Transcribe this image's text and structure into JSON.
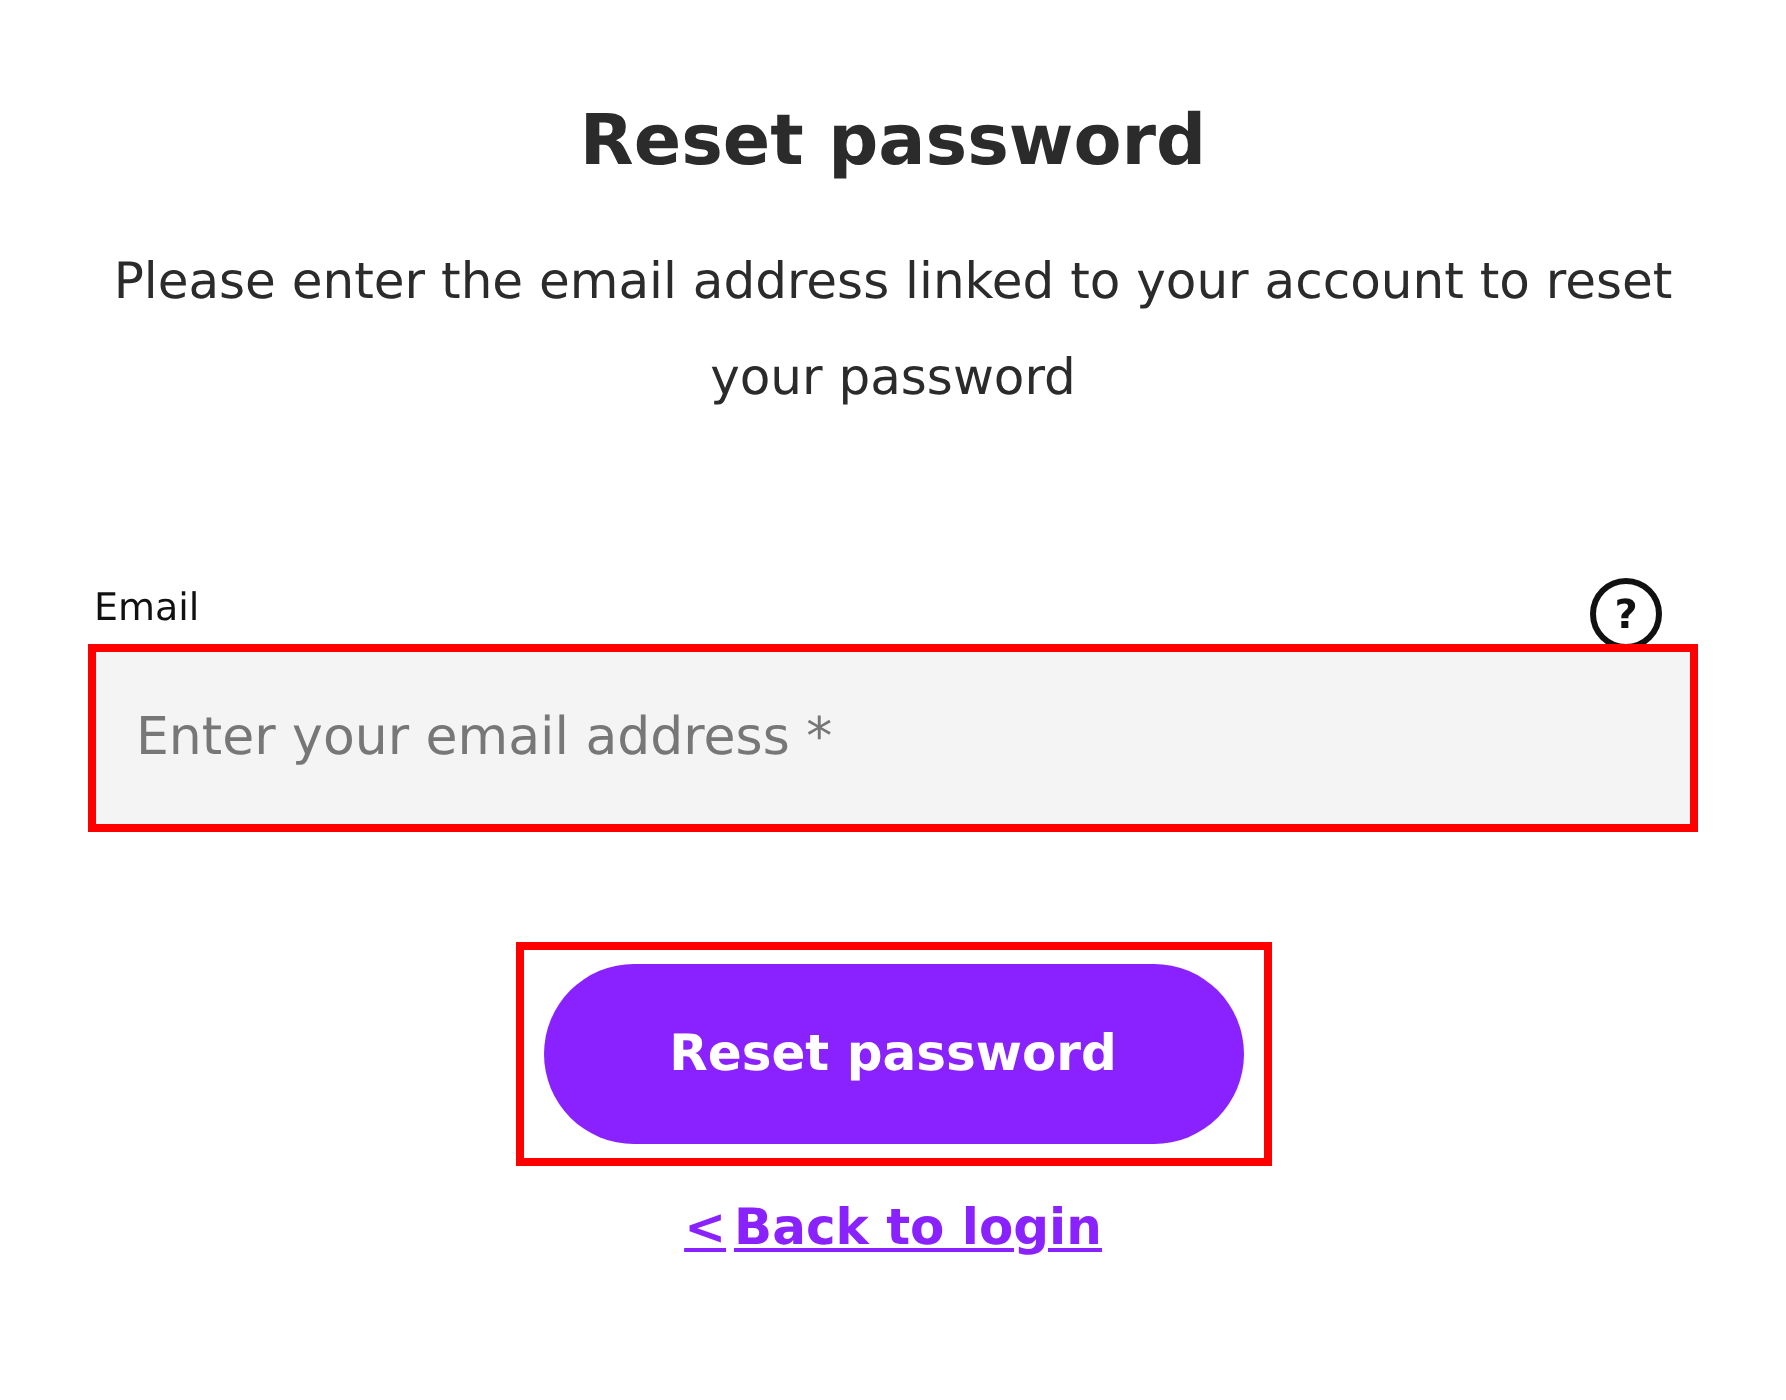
{
  "title": "Reset password",
  "instructions": "Please enter the email address linked to your account to reset your password",
  "email_field": {
    "label": "Email",
    "help_symbol": "?",
    "placeholder": "Enter your email address *",
    "highlighted": true
  },
  "submit_button": {
    "label": "Reset password",
    "highlighted": true
  },
  "back_link": {
    "icon": "<",
    "label": "Back to login"
  }
}
